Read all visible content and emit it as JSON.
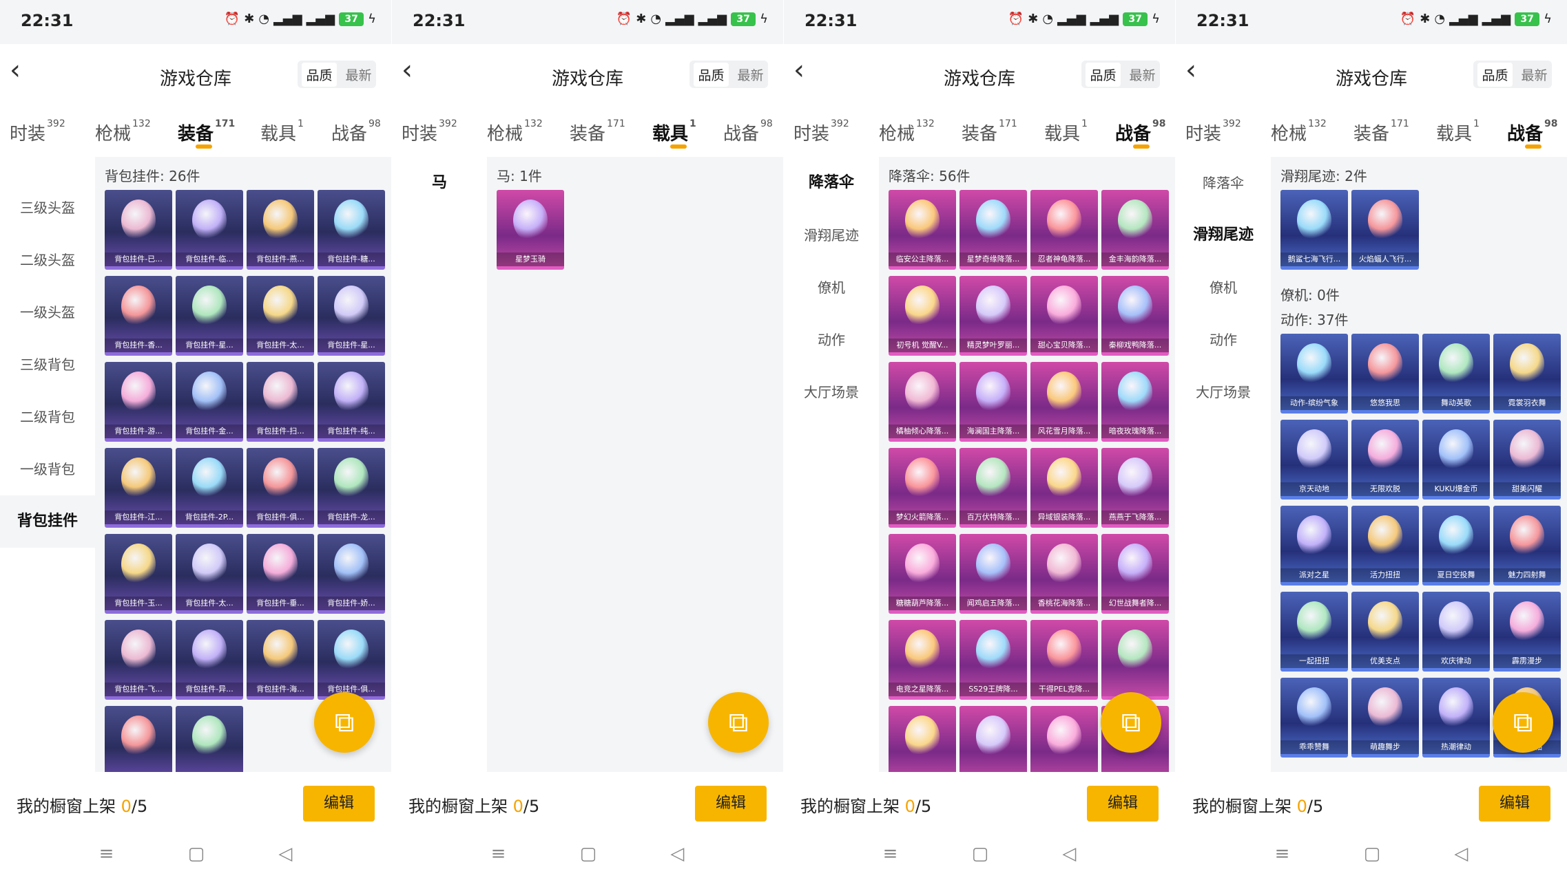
{
  "status": {
    "time": "22:31",
    "battery": "37"
  },
  "header": {
    "title": "游戏仓库",
    "sort_quality": "品质",
    "sort_latest": "最新"
  },
  "tabs": [
    {
      "label": "时装",
      "count": "392"
    },
    {
      "label": "枪械",
      "count": "132"
    },
    {
      "label": "装备",
      "count": "171"
    },
    {
      "label": "载具",
      "count": "1"
    },
    {
      "label": "战备",
      "count": "98"
    }
  ],
  "bottom": {
    "text": "我的橱窗上架",
    "count": "0",
    "total": "/5",
    "edit": "编辑"
  },
  "panels": [
    {
      "active_tab": 2,
      "sidebar": [
        "三级头盔",
        "二级头盔",
        "一级头盔",
        "三级背包",
        "二级背包",
        "一级背包",
        "背包挂件"
      ],
      "sidebar_active": 6,
      "sections": [
        {
          "title": "背包挂件: 26件",
          "items": [
            "背包挂件-已...",
            "背包挂件-临...",
            "背包挂件-燕...",
            "背包挂件-糖...",
            "背包挂件-香...",
            "背包挂件-星...",
            "背包挂件-太...",
            "背包挂件-星...",
            "背包挂件-游...",
            "背包挂件-金...",
            "背包挂件-扫...",
            "背包挂件-纯...",
            "背包挂件-江...",
            "背包挂件-2P...",
            "背包挂件-俱...",
            "背包挂件-龙...",
            "背包挂件-玉...",
            "背包挂件-太...",
            "背包挂件-垂...",
            "背包挂件-娇...",
            "背包挂件-飞...",
            "背包挂件-异...",
            "背包挂件-海...",
            "背包挂件-俱...",
            "",
            ""
          ]
        }
      ]
    },
    {
      "active_tab": 3,
      "sidebar": [
        "马"
      ],
      "sidebar_active": 0,
      "sections": [
        {
          "title": "马: 1件",
          "items": [
            "星梦玉骑"
          ]
        }
      ]
    },
    {
      "active_tab": 4,
      "sidebar": [
        "降落伞",
        "滑翔尾迹",
        "僚机",
        "动作",
        "大厅场景"
      ],
      "sidebar_active": 0,
      "sections": [
        {
          "title": "降落伞: 56件",
          "items": [
            "临安公主降落...",
            "星梦奇缘降落...",
            "忍者神龟降落...",
            "金丰海韵降落...",
            "初号机 觉醒V...",
            "精灵梦叶罗丽...",
            "甜心宝贝降落...",
            "秦柳戏鸭降落...",
            "橘柚倾心降落...",
            "海澜国主降落...",
            "风花雪月降落...",
            "暗夜玫瑰降落...",
            "梦幻火箭降落...",
            "百万伏特降落...",
            "异域银装降落...",
            "燕燕于飞降落...",
            "糖糖葫芦降落...",
            "闻鸡启五降落...",
            "香桃花海降落...",
            "幻世战舞者降...",
            "电竞之星降落...",
            "SS29王牌降...",
            "干得PEL克降...",
            "",
            "",
            "",
            "",
            ""
          ]
        }
      ]
    },
    {
      "active_tab": 4,
      "sidebar": [
        "降落伞",
        "滑翔尾迹",
        "僚机",
        "动作",
        "大厅场景"
      ],
      "sidebar_active": 1,
      "sections": [
        {
          "title": "滑翔尾迹: 2件",
          "items": [
            "鹅鲨七海飞行...",
            "火焰蝠人飞行..."
          ]
        },
        {
          "title": "僚机: 0件",
          "items": []
        },
        {
          "title": "动作: 37件",
          "items": [
            "动作-缤纷气象",
            "悠悠我思",
            "舞动英歌",
            "霓裳羽衣舞",
            "京天动地",
            "无限欢脱",
            "KUKU爆金币",
            "甜美闪耀",
            "派对之星",
            "活力扭扭",
            "夏日空投舞",
            "魅力四射舞",
            "一起扭扭",
            "优美支点",
            "欢庆律动",
            "霹雳漫步",
            "乖乖赞舞",
            "萌趣舞步",
            "热潮律动",
            "快乐领袖"
          ]
        }
      ]
    }
  ]
}
